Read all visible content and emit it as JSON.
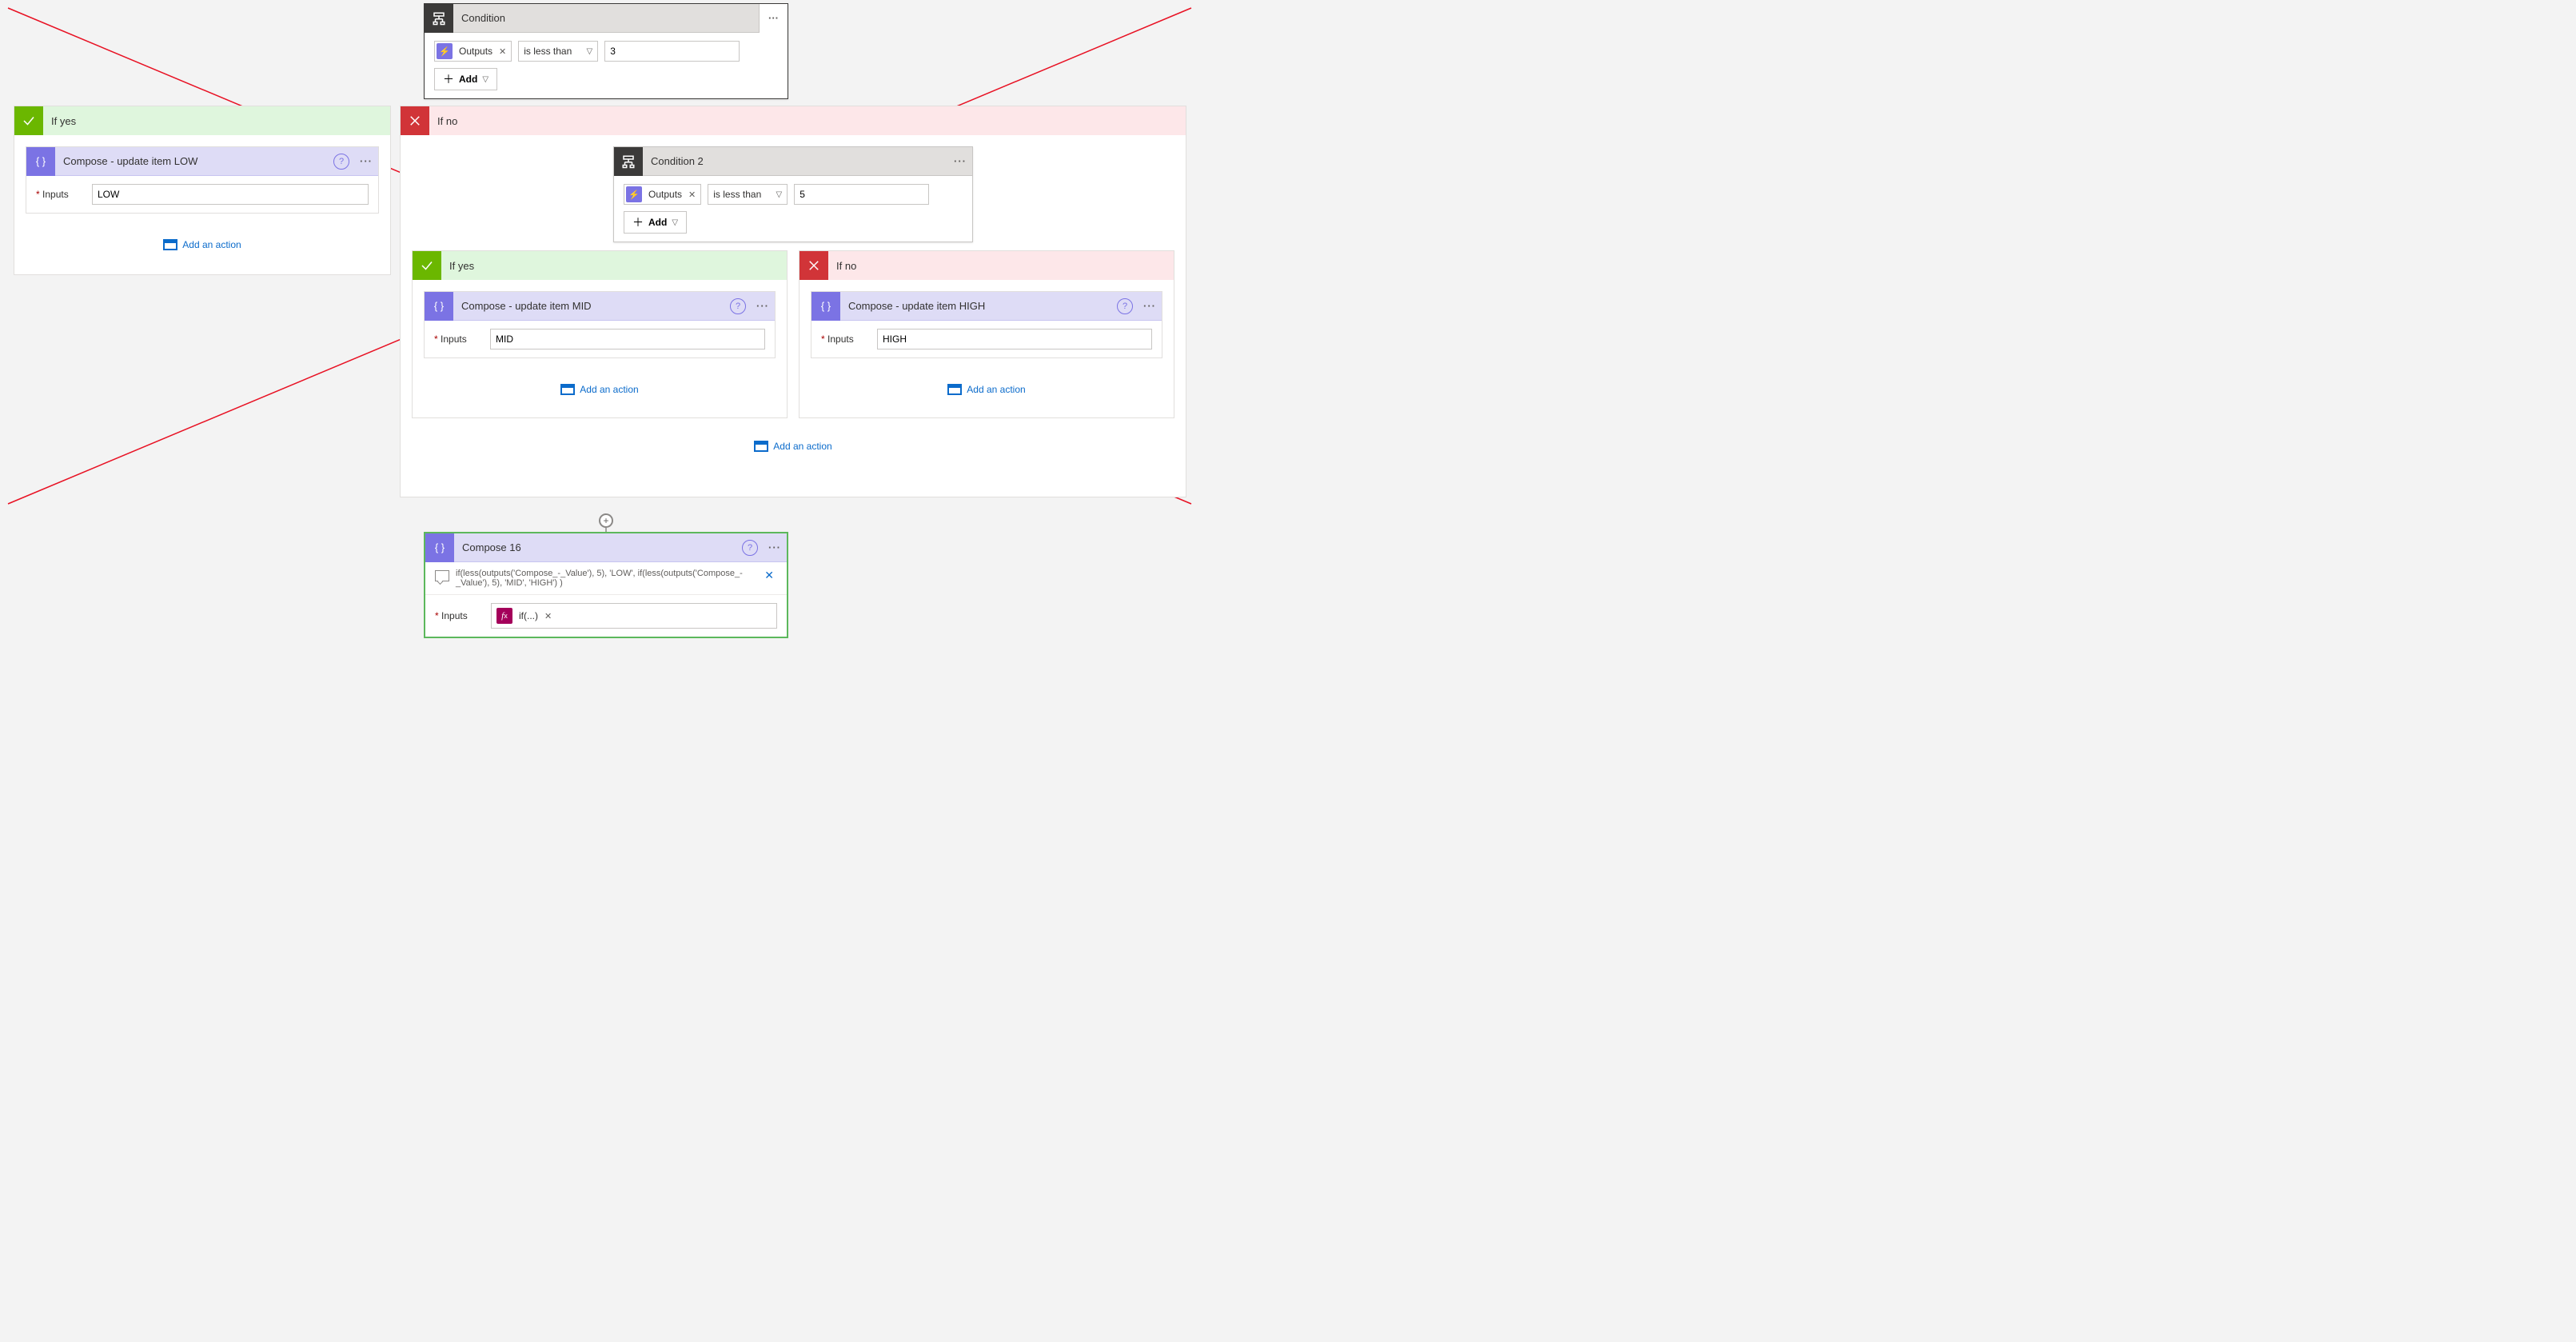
{
  "condition1": {
    "title": "Condition",
    "token": "Outputs",
    "operator": "is less than",
    "value": "3",
    "add_label": "Add"
  },
  "branches": {
    "yes_label": "If yes",
    "no_label": "If no",
    "add_action": "Add an action"
  },
  "compose_low": {
    "title": "Compose - update item LOW",
    "input_label": "Inputs",
    "input_value": "LOW"
  },
  "condition2": {
    "title": "Condition 2",
    "token": "Outputs",
    "operator": "is less than",
    "value": "5",
    "add_label": "Add"
  },
  "compose_mid": {
    "title": "Compose - update item MID",
    "input_label": "Inputs",
    "input_value": "MID"
  },
  "compose_high": {
    "title": "Compose - update item HIGH",
    "input_label": "Inputs",
    "input_value": "HIGH"
  },
  "compose16": {
    "title": "Compose 16",
    "comment": "if(less(outputs('Compose_-_Value'), 5), 'LOW', if(less(outputs('Compose_-_Value'), 5), 'MID', 'HIGH') )",
    "input_label": "Inputs",
    "token": "if(...)"
  }
}
